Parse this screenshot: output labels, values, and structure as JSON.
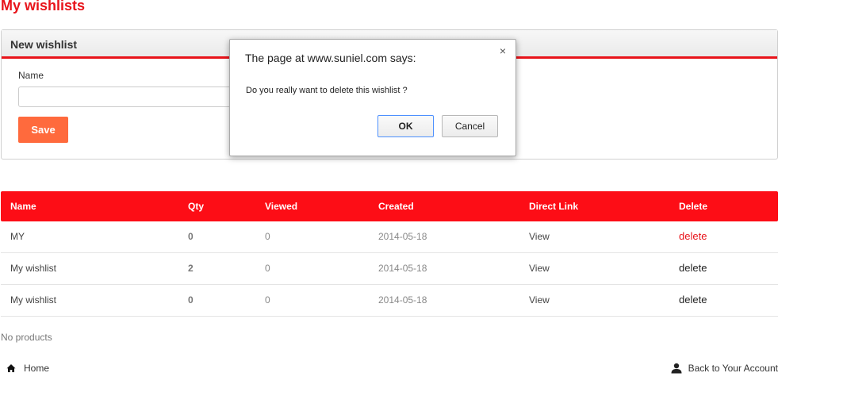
{
  "page": {
    "title": "My wishlists"
  },
  "new_wishlist": {
    "title": "New wishlist",
    "name_label": "Name",
    "name_value": "",
    "save_label": "Save"
  },
  "table": {
    "headers": [
      "Name",
      "Qty",
      "Viewed",
      "Created",
      "Direct Link",
      "Delete"
    ],
    "rows": [
      {
        "name": "MY",
        "qty": "0",
        "viewed": "0",
        "created": "2014-05-18",
        "link": "View",
        "delete": "delete"
      },
      {
        "name": "My wishlist",
        "qty": "2",
        "viewed": "0",
        "created": "2014-05-18",
        "link": "View",
        "delete": "delete"
      },
      {
        "name": "My wishlist",
        "qty": "0",
        "viewed": "0",
        "created": "2014-05-18",
        "link": "View",
        "delete": "delete"
      }
    ]
  },
  "no_products": "No products",
  "footer": {
    "home_label": "Home",
    "home_icon": "home-icon",
    "account_label": "Back to Your Account",
    "account_icon": "user-icon"
  },
  "dialog": {
    "title": "The page at www.suniel.com says:",
    "message": "Do you really want to delete this wishlist ?",
    "ok_label": "OK",
    "cancel_label": "Cancel",
    "close_glyph": "×"
  },
  "colors": {
    "accent": "#e8131a",
    "header_bg": "#fd0d16",
    "save_button": "#ff6a3d"
  }
}
